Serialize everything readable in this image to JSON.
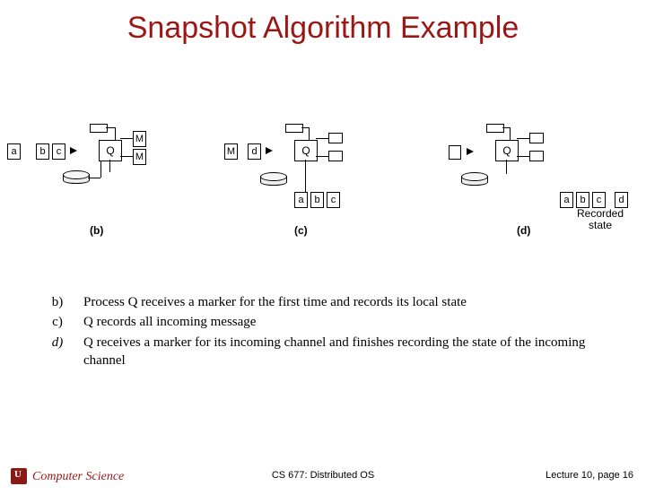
{
  "title": "Snapshot Algorithm Example",
  "diagram": {
    "labels": {
      "a": "a",
      "b": "b",
      "c": "c",
      "d": "d",
      "Q": "Q",
      "M": "M"
    },
    "sub_b": "(b)",
    "sub_c": "(c)",
    "sub_d": "(d)",
    "recorded": "Recorded\nstate"
  },
  "steps": {
    "b": {
      "label": "b)",
      "text": "Process Q receives a marker for the first time and records its local state"
    },
    "c": {
      "label": "c)",
      "text": "Q records all incoming message"
    },
    "d": {
      "label": "d)",
      "text": "Q receives a marker for its incoming channel and finishes recording the state of the incoming channel"
    }
  },
  "footer": {
    "left": "Computer Science",
    "center": "CS 677: Distributed OS",
    "right": "Lecture 10, page 16"
  }
}
